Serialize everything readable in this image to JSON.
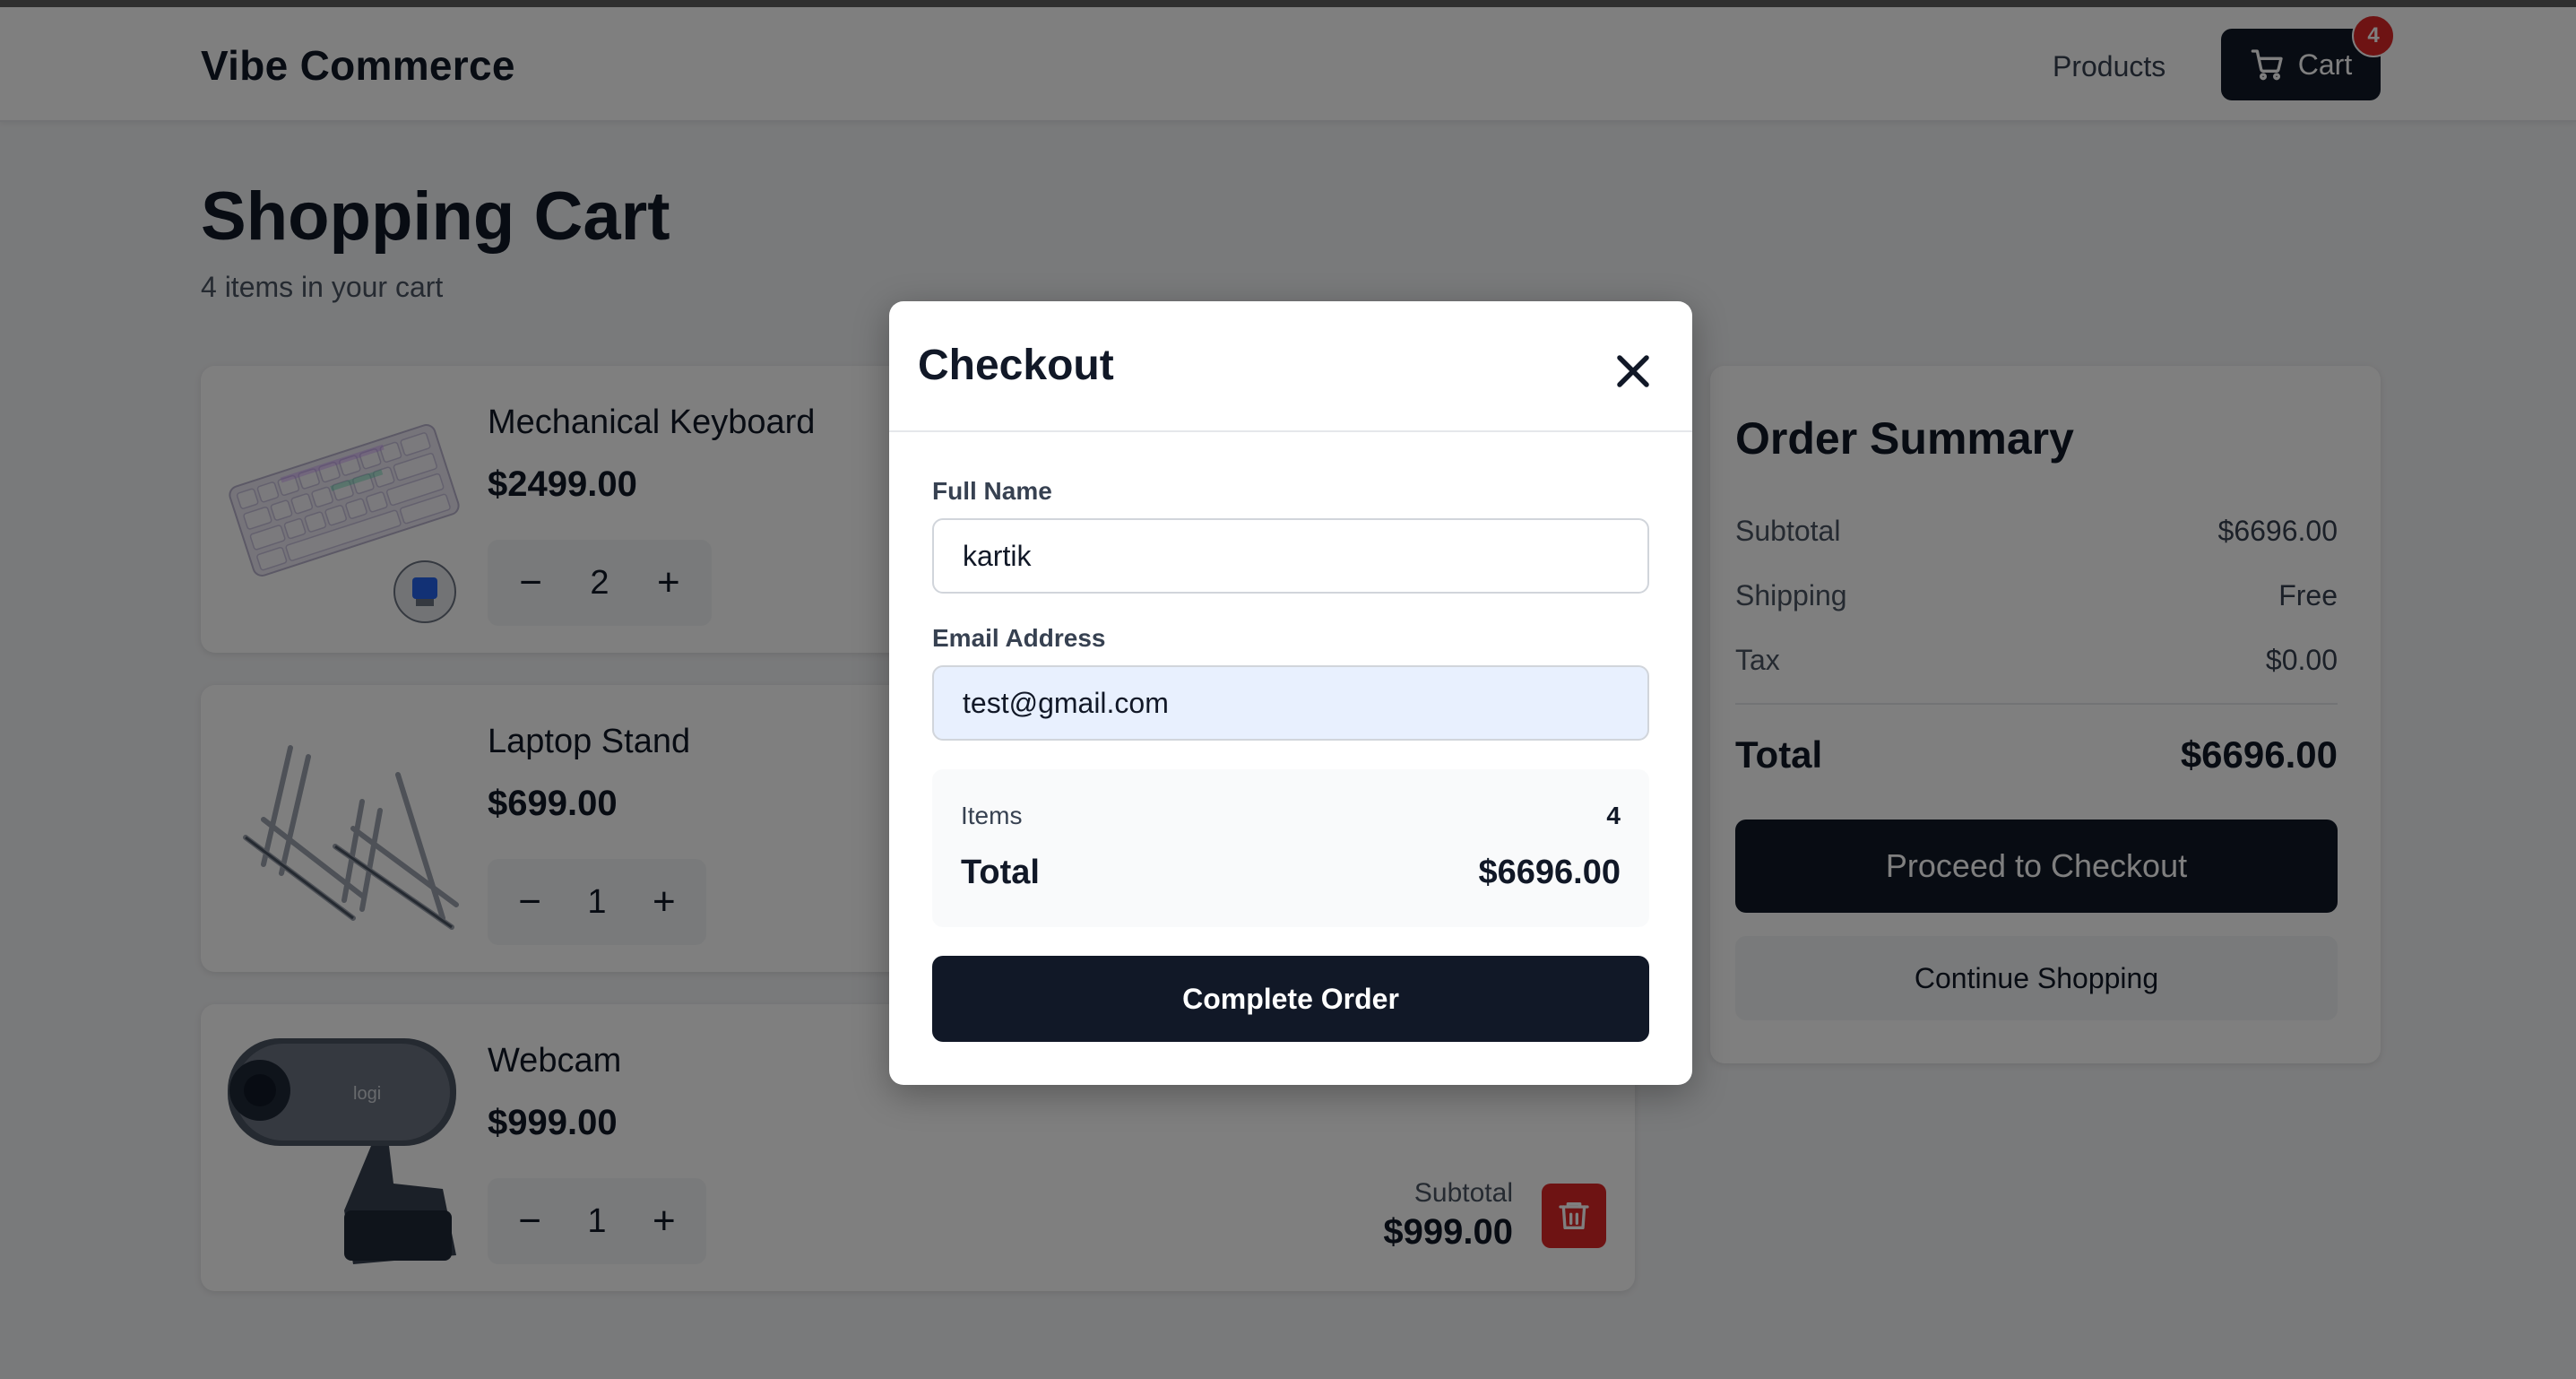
{
  "header": {
    "brand": "Vibe Commerce",
    "nav_products": "Products",
    "cart_label": "Cart",
    "cart_count": "4"
  },
  "page": {
    "title": "Shopping Cart",
    "subtitle": "4 items in your cart"
  },
  "cart_items": [
    {
      "name": "Mechanical Keyboard",
      "price": "$2499.00",
      "qty": "2",
      "image_icon": "keyboard-image"
    },
    {
      "name": "Laptop Stand",
      "price": "$699.00",
      "qty": "1",
      "image_icon": "laptop-stand-image"
    },
    {
      "name": "Webcam",
      "price": "$999.00",
      "qty": "1",
      "image_icon": "webcam-image",
      "subtotal_label": "Subtotal",
      "subtotal": "$999.00"
    }
  ],
  "summary": {
    "title": "Order Summary",
    "rows": [
      {
        "label": "Subtotal",
        "value": "$6696.00"
      },
      {
        "label": "Shipping",
        "value": "Free"
      },
      {
        "label": "Tax",
        "value": "$0.00"
      }
    ],
    "total_label": "Total",
    "total_value": "$6696.00",
    "checkout_button": "Proceed to Checkout",
    "continue_button": "Continue Shopping"
  },
  "modal": {
    "title": "Checkout",
    "name_label": "Full Name",
    "name_value": "kartik",
    "email_label": "Email Address",
    "email_value": "test@gmail.com",
    "items_label": "Items",
    "items_value": "4",
    "total_label": "Total",
    "total_value": "$6696.00",
    "complete_button": "Complete Order"
  },
  "colors": {
    "primary": "#111827",
    "danger": "#dc2626",
    "autofill": "#e8f0fe"
  }
}
